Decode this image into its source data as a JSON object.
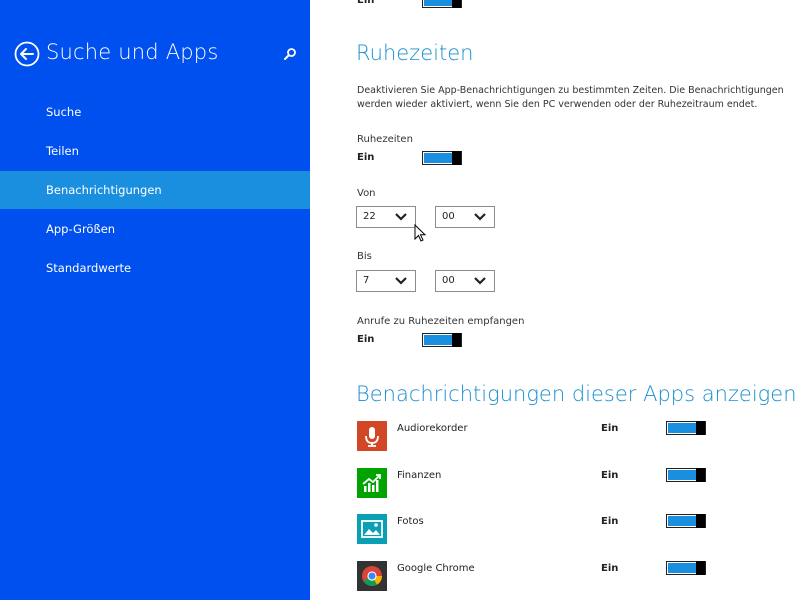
{
  "sidebar": {
    "title": "Suche und Apps",
    "items": [
      {
        "label": "Suche"
      },
      {
        "label": "Teilen"
      },
      {
        "label": "Benachrichtigungen"
      },
      {
        "label": "App-Größen"
      },
      {
        "label": "Standardwerte"
      }
    ],
    "active_index": 2
  },
  "top_cut": {
    "state": "Ein"
  },
  "quiet_hours": {
    "heading": "Ruhezeiten",
    "description_line1": "Deaktivieren Sie App-Benachrichtigungen zu bestimmten Zeiten. Die Benachrichtigungen",
    "description_line2": "werden wieder aktiviert, wenn Sie den PC verwenden oder der Ruhezeitraum endet.",
    "toggle_label": "Ruhezeiten",
    "toggle_state": "Ein",
    "from_label": "Von",
    "from_hour": "22",
    "from_minute": "00",
    "to_label": "Bis",
    "to_hour": "7",
    "to_minute": "00",
    "calls_label": "Anrufe zu Ruhezeiten empfangen",
    "calls_state": "Ein"
  },
  "apps_section": {
    "heading": "Benachrichtigungen dieser Apps anzeigen",
    "apps": [
      {
        "name": "Audiorekorder",
        "state": "Ein",
        "icon": "microphone-icon",
        "color": "#d24726"
      },
      {
        "name": "Finanzen",
        "state": "Ein",
        "icon": "chart-icon",
        "color": "#00a300"
      },
      {
        "name": "Fotos",
        "state": "Ein",
        "icon": "photo-icon",
        "color": "#0a9fb5"
      },
      {
        "name": "Google Chrome",
        "state": "Ein",
        "icon": "chrome-icon",
        "color": "#333333"
      }
    ]
  },
  "colors": {
    "sidebar": "#0050ef",
    "active": "#1a8fe0",
    "accent": "#1a8fd0"
  }
}
